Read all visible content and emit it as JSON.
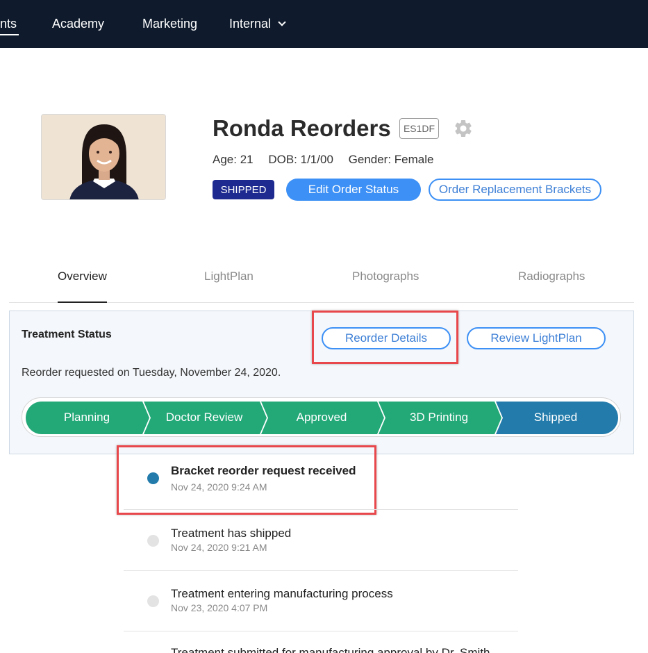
{
  "nav": {
    "items": [
      {
        "label": "nts"
      },
      {
        "label": "Academy"
      },
      {
        "label": "Marketing"
      },
      {
        "label": "Internal"
      }
    ]
  },
  "patient": {
    "name": "Ronda Reorders",
    "case_code": "ES1DF",
    "age": "Age: 21",
    "dob": "DOB: 1/1/00",
    "gender": "Gender: Female"
  },
  "actions": {
    "status_badge": "SHIPPED",
    "edit_order_status": "Edit Order Status",
    "order_replacement": "Order Replacement Brackets"
  },
  "tabs": [
    {
      "label": "Overview",
      "active": true
    },
    {
      "label": "LightPlan",
      "active": false
    },
    {
      "label": "Photographs",
      "active": false
    },
    {
      "label": "Radiographs",
      "active": false
    }
  ],
  "treatment_status": {
    "title": "Treatment Status",
    "reorder_details": "Reorder Details",
    "review_lightplan": "Review LightPlan",
    "reorder_text": "Reorder requested on Tuesday, November 24, 2020.",
    "steps": [
      {
        "label": "Planning"
      },
      {
        "label": "Doctor Review"
      },
      {
        "label": "Approved"
      },
      {
        "label": "3D Printing"
      },
      {
        "label": "Shipped"
      }
    ],
    "colors": {
      "completed": "#23a878",
      "current": "#227bab"
    }
  },
  "timeline": [
    {
      "title": "Bracket reorder request received",
      "time": "Nov 24, 2020 9:24 AM",
      "current": true
    },
    {
      "title": "Treatment has shipped",
      "time": "Nov 24, 2020 9:21 AM",
      "current": false
    },
    {
      "title": "Treatment entering manufacturing process",
      "time": "Nov 23, 2020 4:07 PM",
      "current": false
    },
    {
      "title": "Treatment submitted for manufacturing approval by Dr. Smith",
      "time": "",
      "current": false
    }
  ],
  "icons": {
    "settings": "gear-icon",
    "dropdown": "chevron-down-icon"
  },
  "colors": {
    "nav_bg": "#0f1b2d",
    "accent": "#3d90f5",
    "badge": "#1e2a8f",
    "highlight": "#e8484b"
  }
}
